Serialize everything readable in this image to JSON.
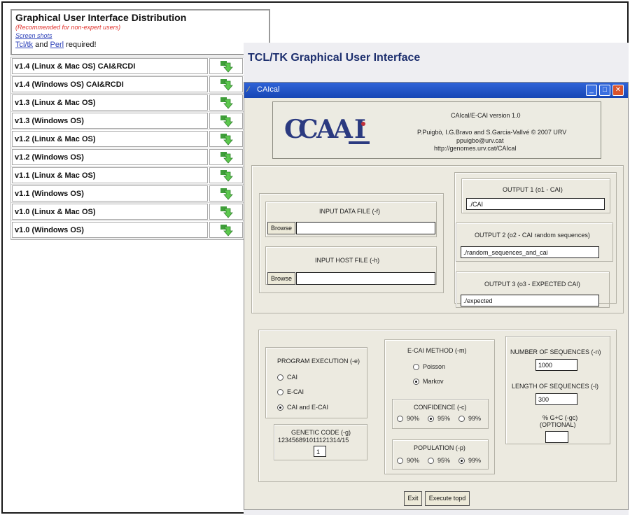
{
  "distribution": {
    "title": "Graphical User Interface Distribution",
    "note": "(Recommended for non-expert users)",
    "screenshots_link": "Screen shots",
    "req_tcltk": "Tcl/tk",
    "req_and": "and",
    "req_perl": "Perl",
    "req_suffix": "required!",
    "download_icon": "download-arrow-icon",
    "versions": [
      "v1.4 (Linux & Mac OS) CAI&RCDI",
      "v1.4 (Windows OS) CAI&RCDI",
      "v1.3 (Linux & Mac OS)",
      "v1.3 (Windows OS)",
      "v1.2 (Linux & Mac OS)",
      "v1.2 (Windows OS)",
      "v1.1 (Linux & Mac OS)",
      "v1.1 (Windows OS)",
      "v1.0 (Linux & Mac OS)",
      "v1.0 (Windows OS)"
    ]
  },
  "tcl_title": "TCL/TK Graphical User Interface",
  "window": {
    "title": "CAIcal",
    "logo_text": "CAAI",
    "about": {
      "line1": "CAIcal/E-CAI version 1.0",
      "line2": "P.Puigbò, I.G.Bravo and S.Garcia-Vallvé © 2007 URV",
      "line3": "ppuigbo@urv.cat",
      "line4": "http://genomes.urv.cat/CAIcal"
    },
    "input_data": {
      "label": "INPUT DATA FILE (-f)",
      "browse": "Browse",
      "value": ""
    },
    "input_host": {
      "label": "INPUT HOST FILE (-h)",
      "browse": "Browse",
      "value": ""
    },
    "output1": {
      "label": "OUTPUT 1 (o1 - CAI)",
      "value": "./CAI"
    },
    "output2": {
      "label": "OUTPUT 2 (o2 - CAI random sequences)",
      "value": "./random_sequences_and_cai"
    },
    "output3": {
      "label": "OUTPUT 3 (o3 - EXPECTED CAI)",
      "value": "./expected"
    },
    "program_execution": {
      "label": "PROGRAM EXECUTION (-e)",
      "options": [
        "CAI",
        "E-CAI",
        "CAI and E-CAI"
      ],
      "selected": "CAI and E-CAI"
    },
    "genetic_code": {
      "label": "GENETIC CODE (-g)",
      "codes": "123456891011121314/15",
      "value": "1"
    },
    "ecai_method": {
      "label": "E-CAI METHOD (-m)",
      "options": [
        "Poisson",
        "Markov"
      ],
      "selected": "Markov"
    },
    "confidence": {
      "label": "CONFIDENCE (-c)",
      "options": [
        "90%",
        "95%",
        "99%"
      ],
      "selected": "95%"
    },
    "population": {
      "label": "POPULATION (-p)",
      "options": [
        "90%",
        "95%",
        "99%"
      ],
      "selected": "99%"
    },
    "num_sequences": {
      "label": "NUMBER OF SEQUENCES (-n)",
      "value": "1000"
    },
    "len_sequences": {
      "label": "LENGTH OF SEQUENCES (-l)",
      "value": "300"
    },
    "gc": {
      "label": "% G+C (-gc)",
      "sublabel": "(OPTIONAL)",
      "value": ""
    },
    "exit_label": "Exit",
    "execute_label": "Execute topd"
  }
}
